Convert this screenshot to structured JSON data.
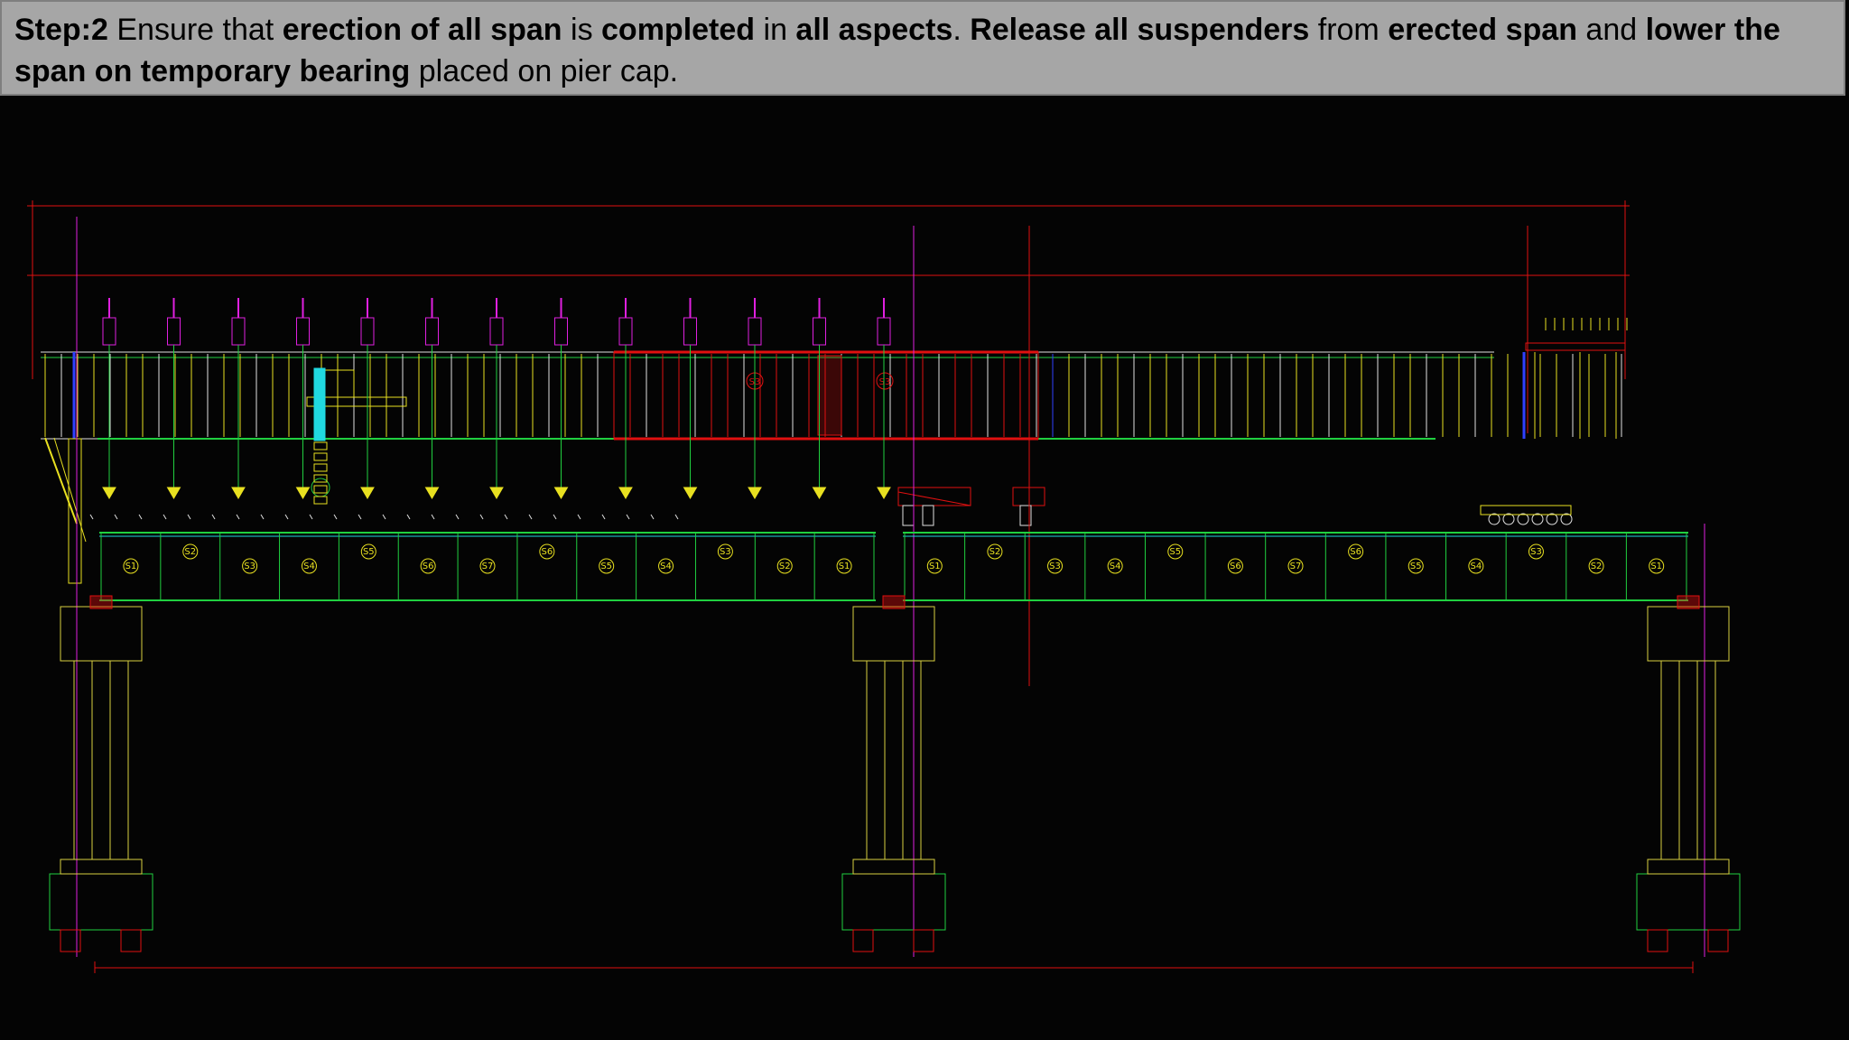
{
  "caption": {
    "parts": [
      {
        "text": "Step:2",
        "bold": true
      },
      {
        "text": " Ensure that ",
        "bold": false
      },
      {
        "text": "erection of all span",
        "bold": true
      },
      {
        "text": " is ",
        "bold": false
      },
      {
        "text": "completed",
        "bold": true
      },
      {
        "text": " in ",
        "bold": false
      },
      {
        "text": "all aspects",
        "bold": true
      },
      {
        "text": ". ",
        "bold": false
      },
      {
        "text": "Release all suspenders",
        "bold": true
      },
      {
        "text": " from ",
        "bold": false
      },
      {
        "text": "erected span",
        "bold": true
      },
      {
        "text": " and ",
        "bold": false
      },
      {
        "text": "lower the span on temporary bearing",
        "bold": true
      },
      {
        "text": " placed on pier cap.",
        "bold": false
      }
    ]
  },
  "drawing": {
    "colors": {
      "background": "#040404",
      "girder": "#e0e0e0",
      "red": "#e01010",
      "magenta": "#e020e0",
      "yellow": "#e8e020",
      "green": "#20d040",
      "cyan": "#20d8e0",
      "pier": "#d8d040",
      "blue": "#3040ff"
    },
    "span1_segment_labels": [
      "S1",
      "S2",
      "S3",
      "S4",
      "S5",
      "S6",
      "S7",
      "S6",
      "S5",
      "S4",
      "S3",
      "S2",
      "S1"
    ],
    "span2_segment_labels": [
      "S1",
      "S2",
      "S3",
      "S4",
      "S5",
      "S6",
      "S7",
      "S6",
      "S5",
      "S4",
      "S3",
      "S2",
      "S1"
    ],
    "launching_girder_labels": [
      "S3",
      "S3"
    ],
    "suspender_count": 13
  }
}
